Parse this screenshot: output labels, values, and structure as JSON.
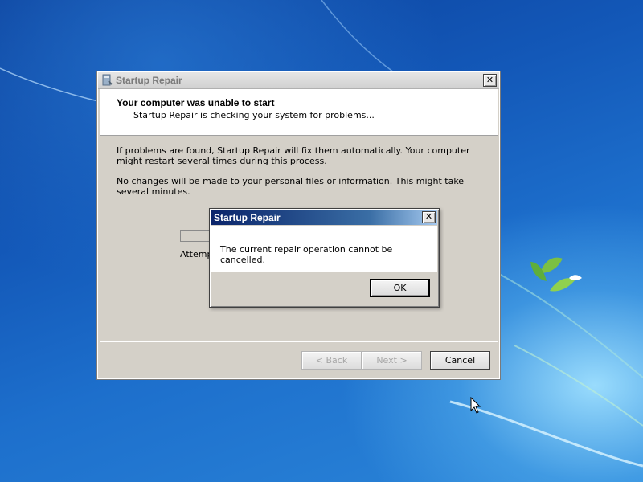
{
  "main_window": {
    "title": "Startup Repair",
    "close_glyph": "✕",
    "header": {
      "title": "Your computer was unable to start",
      "subtitle": "Startup Repair is checking your system for problems..."
    },
    "body": {
      "paragraph1": "If problems are found, Startup Repair will fix them automatically. Your computer might restart several times during this process.",
      "paragraph2": "No changes will be made to your personal files or information. This might take several minutes.",
      "attempt_label": "Attempting repairs..."
    },
    "buttons": {
      "back": "< Back",
      "next": "Next >",
      "cancel": "Cancel"
    }
  },
  "dialog": {
    "title": "Startup Repair",
    "close_glyph": "✕",
    "message": "The current repair operation cannot be cancelled.",
    "ok_label": "OK"
  },
  "icons": {
    "window_icon": "startup-repair-icon",
    "cursor": "mouse-pointer"
  },
  "colors": {
    "dialog_titlebar": "#0a246a",
    "window_face": "#d4d0c8",
    "desktop": "#1358b8"
  }
}
